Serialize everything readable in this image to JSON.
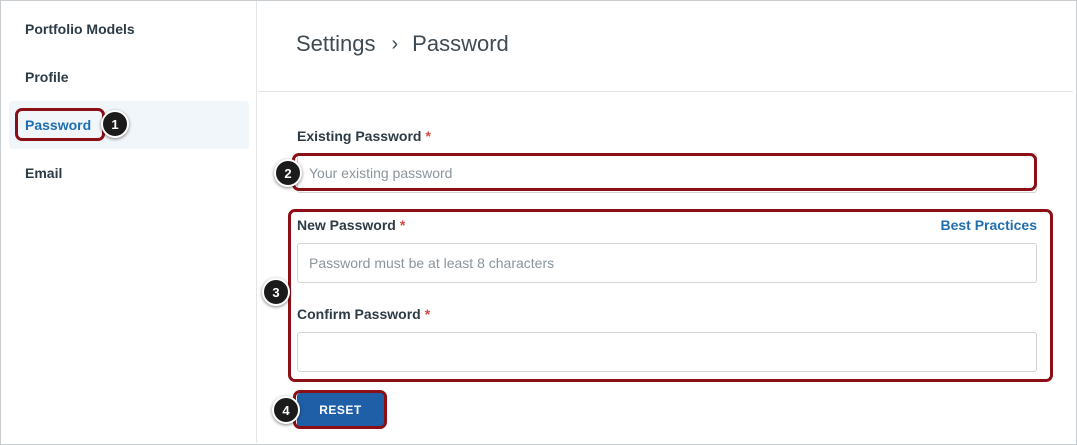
{
  "sidebar": {
    "items": [
      {
        "label": "Portfolio Models"
      },
      {
        "label": "Profile"
      },
      {
        "label": "Password",
        "active": true
      },
      {
        "label": "Email"
      }
    ]
  },
  "header": {
    "breadcrumb": {
      "parent": "Settings",
      "separator": "›",
      "current": "Password"
    }
  },
  "form": {
    "existing": {
      "label": "Existing Password",
      "required_mark": "*",
      "placeholder": "Your existing password",
      "value": ""
    },
    "new_password": {
      "label": "New Password",
      "required_mark": "*",
      "placeholder": "Password must be at least 8 characters",
      "value": ""
    },
    "best_practices_link": "Best Practices",
    "confirm": {
      "label": "Confirm Password",
      "required_mark": "*",
      "placeholder": "",
      "value": ""
    },
    "reset_button": "RESET"
  },
  "annotations": {
    "badges": [
      "1",
      "2",
      "3",
      "4"
    ],
    "highlight_color": "#8b0f14"
  },
  "colors": {
    "accent": "#1f6fb0",
    "button": "#1f5fa8",
    "required": "#d24a43",
    "active_nav_bg": "#f1f6fb"
  }
}
